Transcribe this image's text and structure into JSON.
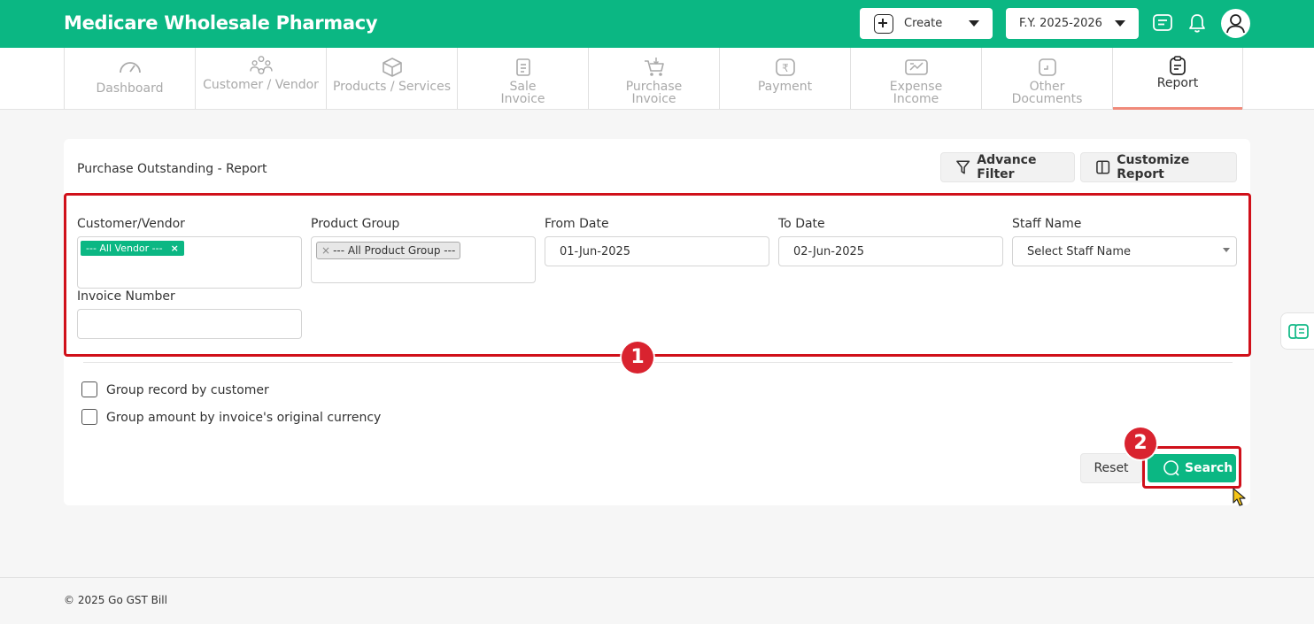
{
  "header": {
    "brand": "Medicare Wholesale Pharmacy",
    "create_label": "Create",
    "fy_label": "F.Y. 2025-2026",
    "icons": [
      "chat-icon",
      "bell-icon",
      "user-avatar-icon"
    ]
  },
  "nav": {
    "items": [
      {
        "line1": "Dashboard",
        "line2": "",
        "icon": "speedometer-icon"
      },
      {
        "line1": "Customer / Vendor",
        "line2": "",
        "icon": "users-icon"
      },
      {
        "line1": "Products / Services",
        "line2": "",
        "icon": "box-icon"
      },
      {
        "line1": "Sale",
        "line2": "Invoice",
        "icon": "receipt-icon"
      },
      {
        "line1": "Purchase",
        "line2": "Invoice",
        "icon": "cart-icon"
      },
      {
        "line1": "Payment",
        "line2": "",
        "icon": "rupee-icon"
      },
      {
        "line1": "Expense",
        "line2": "Income",
        "icon": "wallet-icon"
      },
      {
        "line1": "Other",
        "line2": "Documents",
        "icon": "document-icon"
      },
      {
        "line1": "Report",
        "line2": "",
        "icon": "clipboard-icon"
      }
    ],
    "active": "Report"
  },
  "report": {
    "title": "Purchase Outstanding - Report",
    "advance_filter_label": "Advance Filter",
    "customize_report_label": "Customize Report",
    "fields": {
      "customer_vendor": {
        "label": "Customer/Vendor",
        "tag": "--- All Vendor ---",
        "remove": "×"
      },
      "product_group": {
        "label": "Product Group",
        "tag": "--- All Product Group ---",
        "remove": "×"
      },
      "from_date": {
        "label": "From Date",
        "value": "01-Jun-2025"
      },
      "to_date": {
        "label": "To Date",
        "value": "02-Jun-2025"
      },
      "staff_name": {
        "label": "Staff Name",
        "placeholder": "Select Staff Name"
      },
      "invoice_number": {
        "label": "Invoice Number",
        "value": ""
      }
    },
    "checkboxes": [
      {
        "label": "Group record by customer",
        "checked": false
      },
      {
        "label": "Group amount by invoice's original currency",
        "checked": false
      }
    ],
    "reset_label": "Reset",
    "search_label": "Search"
  },
  "annotations": {
    "step1": "1",
    "step2": "2",
    "color": "#d0101a"
  },
  "footer": {
    "copyright": "© 2025 Go GST Bill"
  },
  "colors": {
    "brand_green": "#0bb783",
    "active_tab_underline": "#f08a7a"
  }
}
